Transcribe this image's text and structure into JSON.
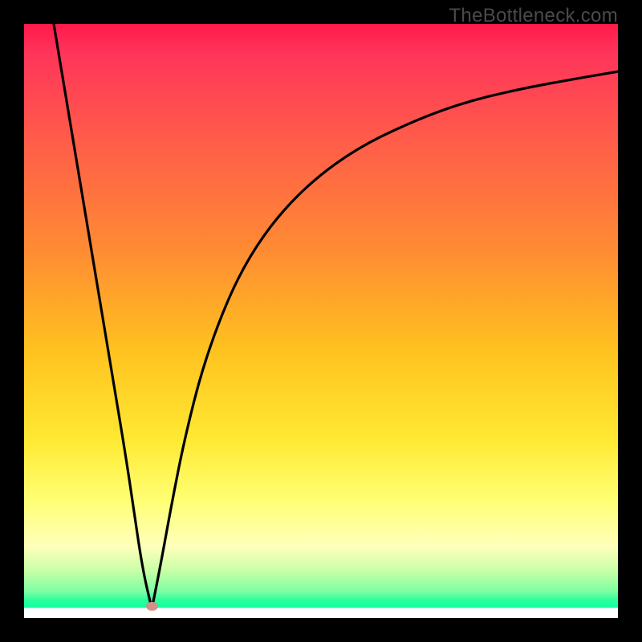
{
  "watermark": "TheBottleneck.com",
  "marker": {
    "x_pct": 21.5,
    "y_pct": 98.0,
    "color": "#d48f87"
  },
  "chart_data": {
    "type": "line",
    "title": "",
    "xlabel": "",
    "ylabel": "",
    "xlim": [
      0,
      100
    ],
    "ylim": [
      0,
      100
    ],
    "annotations": [
      "TheBottleneck.com"
    ],
    "series": [
      {
        "name": "left-branch",
        "x": [
          5,
          7,
          9,
          11,
          13,
          15,
          17,
          18.5,
          20,
          21.5
        ],
        "y": [
          100,
          88,
          76,
          64,
          52,
          40,
          28,
          18,
          8,
          1.5
        ]
      },
      {
        "name": "right-branch",
        "x": [
          21.5,
          23,
          25,
          27,
          30,
          34,
          38,
          43,
          49,
          56,
          64,
          73,
          83,
          94,
          100
        ],
        "y": [
          1.5,
          9,
          20,
          30,
          42,
          53,
          61,
          68,
          74,
          79,
          83,
          86.5,
          89,
          91,
          92
        ]
      }
    ],
    "marker_point": {
      "x": 21.5,
      "y": 1.5
    }
  }
}
